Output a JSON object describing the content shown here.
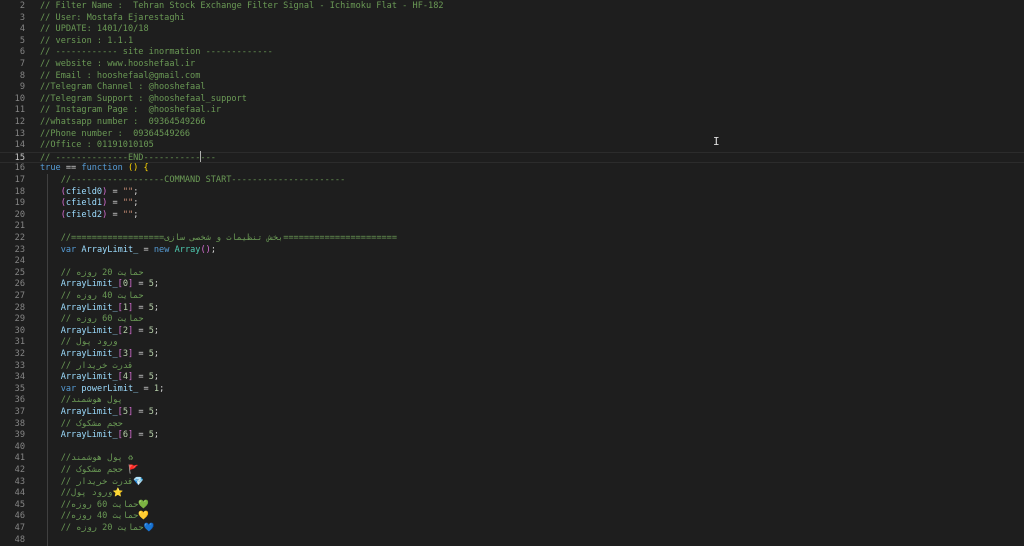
{
  "lines": [
    {
      "num": "2",
      "tokens": [
        {
          "t": "// Filter Name :  Tehran Stock Exchange Filter Signal - Ichimoku Flat - HF-182",
          "c": "c"
        }
      ]
    },
    {
      "num": "3",
      "tokens": [
        {
          "t": "// User: Mostafa Ejarestaghi",
          "c": "c"
        }
      ]
    },
    {
      "num": "4",
      "tokens": [
        {
          "t": "// UPDATE: 1401/10/18",
          "c": "c"
        }
      ]
    },
    {
      "num": "5",
      "tokens": [
        {
          "t": "// version : 1.1.1",
          "c": "c"
        }
      ]
    },
    {
      "num": "6",
      "tokens": [
        {
          "t": "// ------------ site inormation -------------",
          "c": "c"
        }
      ]
    },
    {
      "num": "7",
      "tokens": [
        {
          "t": "// website : www.hooshefaal.ir",
          "c": "c"
        }
      ]
    },
    {
      "num": "8",
      "tokens": [
        {
          "t": "// Email : hooshefaal@gmail.com",
          "c": "c"
        }
      ]
    },
    {
      "num": "9",
      "tokens": [
        {
          "t": "//Telegram Channel : @hooshefaal",
          "c": "c"
        }
      ]
    },
    {
      "num": "10",
      "tokens": [
        {
          "t": "//Telegram Support : @hooshefaal_support",
          "c": "c"
        }
      ]
    },
    {
      "num": "11",
      "tokens": [
        {
          "t": "// Instagram Page :  @hooshefaal.ir",
          "c": "c"
        }
      ]
    },
    {
      "num": "12",
      "tokens": [
        {
          "t": "//whatsapp number :  09364549266",
          "c": "c"
        }
      ]
    },
    {
      "num": "13",
      "tokens": [
        {
          "t": "//Phone number :  09364549266",
          "c": "c"
        }
      ]
    },
    {
      "num": "14",
      "tokens": [
        {
          "t": "//Office : 01191010105",
          "c": "c"
        }
      ]
    },
    {
      "num": "15",
      "current": true,
      "tokens": [
        {
          "t": "// --------------END--------------",
          "c": "c"
        }
      ]
    },
    {
      "num": "16",
      "tokens": [
        {
          "t": "true",
          "c": "k"
        },
        {
          "t": " == ",
          "c": "p"
        },
        {
          "t": "function",
          "c": "k"
        },
        {
          "t": " ",
          "c": "p"
        },
        {
          "t": "()",
          "c": "b1"
        },
        {
          "t": " ",
          "c": "p"
        },
        {
          "t": "{",
          "c": "b1"
        }
      ]
    },
    {
      "num": "17",
      "tokens": [
        {
          "t": "    //------------------COMMAND START----------------------",
          "c": "c"
        }
      ]
    },
    {
      "num": "18",
      "tokens": [
        {
          "t": "    ",
          "c": "p"
        },
        {
          "t": "(",
          "c": "b2"
        },
        {
          "t": "cfield0",
          "c": "v"
        },
        {
          "t": ")",
          "c": "b2"
        },
        {
          "t": " = ",
          "c": "p"
        },
        {
          "t": "\"\"",
          "c": "s"
        },
        {
          "t": ";",
          "c": "p"
        }
      ]
    },
    {
      "num": "19",
      "tokens": [
        {
          "t": "    ",
          "c": "p"
        },
        {
          "t": "(",
          "c": "b2"
        },
        {
          "t": "cfield1",
          "c": "v"
        },
        {
          "t": ")",
          "c": "b2"
        },
        {
          "t": " = ",
          "c": "p"
        },
        {
          "t": "\"\"",
          "c": "s"
        },
        {
          "t": ";",
          "c": "p"
        }
      ]
    },
    {
      "num": "20",
      "tokens": [
        {
          "t": "    ",
          "c": "p"
        },
        {
          "t": "(",
          "c": "b2"
        },
        {
          "t": "cfield2",
          "c": "v"
        },
        {
          "t": ")",
          "c": "b2"
        },
        {
          "t": " = ",
          "c": "p"
        },
        {
          "t": "\"\"",
          "c": "s"
        },
        {
          "t": ";",
          "c": "p"
        }
      ]
    },
    {
      "num": "21",
      "tokens": []
    },
    {
      "num": "22",
      "tokens": [
        {
          "t": "    //==================بخش تنظیمات و شخصی سازی======================",
          "c": "c"
        }
      ]
    },
    {
      "num": "23",
      "tokens": [
        {
          "t": "    ",
          "c": "p"
        },
        {
          "t": "var",
          "c": "k"
        },
        {
          "t": " ",
          "c": "p"
        },
        {
          "t": "ArrayLimit_",
          "c": "v"
        },
        {
          "t": " = ",
          "c": "p"
        },
        {
          "t": "new",
          "c": "k"
        },
        {
          "t": " ",
          "c": "p"
        },
        {
          "t": "Array",
          "c": "t"
        },
        {
          "t": "()",
          "c": "b2"
        },
        {
          "t": ";",
          "c": "p"
        }
      ]
    },
    {
      "num": "24",
      "tokens": []
    },
    {
      "num": "25",
      "tokens": [
        {
          "t": "    // حمایت 20 روزه",
          "c": "c"
        }
      ]
    },
    {
      "num": "26",
      "tokens": [
        {
          "t": "    ",
          "c": "p"
        },
        {
          "t": "ArrayLimit_",
          "c": "v"
        },
        {
          "t": "[",
          "c": "b2"
        },
        {
          "t": "0",
          "c": "n"
        },
        {
          "t": "]",
          "c": "b2"
        },
        {
          "t": " = ",
          "c": "p"
        },
        {
          "t": "5",
          "c": "n"
        },
        {
          "t": ";",
          "c": "p"
        }
      ]
    },
    {
      "num": "27",
      "tokens": [
        {
          "t": "    // حمایت 40 روزه",
          "c": "c"
        }
      ]
    },
    {
      "num": "28",
      "tokens": [
        {
          "t": "    ",
          "c": "p"
        },
        {
          "t": "ArrayLimit_",
          "c": "v"
        },
        {
          "t": "[",
          "c": "b2"
        },
        {
          "t": "1",
          "c": "n"
        },
        {
          "t": "]",
          "c": "b2"
        },
        {
          "t": " = ",
          "c": "p"
        },
        {
          "t": "5",
          "c": "n"
        },
        {
          "t": ";",
          "c": "p"
        }
      ]
    },
    {
      "num": "29",
      "tokens": [
        {
          "t": "    // حمایت 60 روزه",
          "c": "c"
        }
      ]
    },
    {
      "num": "30",
      "tokens": [
        {
          "t": "    ",
          "c": "p"
        },
        {
          "t": "ArrayLimit_",
          "c": "v"
        },
        {
          "t": "[",
          "c": "b2"
        },
        {
          "t": "2",
          "c": "n"
        },
        {
          "t": "]",
          "c": "b2"
        },
        {
          "t": " = ",
          "c": "p"
        },
        {
          "t": "5",
          "c": "n"
        },
        {
          "t": ";",
          "c": "p"
        }
      ]
    },
    {
      "num": "31",
      "tokens": [
        {
          "t": "    // ورود پول",
          "c": "c"
        }
      ]
    },
    {
      "num": "32",
      "tokens": [
        {
          "t": "    ",
          "c": "p"
        },
        {
          "t": "ArrayLimit_",
          "c": "v"
        },
        {
          "t": "[",
          "c": "b2"
        },
        {
          "t": "3",
          "c": "n"
        },
        {
          "t": "]",
          "c": "b2"
        },
        {
          "t": " = ",
          "c": "p"
        },
        {
          "t": "5",
          "c": "n"
        },
        {
          "t": ";",
          "c": "p"
        }
      ]
    },
    {
      "num": "33",
      "tokens": [
        {
          "t": "    // قدرت خریدار",
          "c": "c"
        }
      ]
    },
    {
      "num": "34",
      "tokens": [
        {
          "t": "    ",
          "c": "p"
        },
        {
          "t": "ArrayLimit_",
          "c": "v"
        },
        {
          "t": "[",
          "c": "b2"
        },
        {
          "t": "4",
          "c": "n"
        },
        {
          "t": "]",
          "c": "b2"
        },
        {
          "t": " = ",
          "c": "p"
        },
        {
          "t": "5",
          "c": "n"
        },
        {
          "t": ";",
          "c": "p"
        }
      ]
    },
    {
      "num": "35",
      "tokens": [
        {
          "t": "    ",
          "c": "p"
        },
        {
          "t": "var",
          "c": "k"
        },
        {
          "t": " ",
          "c": "p"
        },
        {
          "t": "powerLimit_",
          "c": "v"
        },
        {
          "t": " = ",
          "c": "p"
        },
        {
          "t": "1",
          "c": "n"
        },
        {
          "t": ";",
          "c": "p"
        }
      ]
    },
    {
      "num": "36",
      "tokens": [
        {
          "t": "    //پول هوشمند",
          "c": "c"
        }
      ]
    },
    {
      "num": "37",
      "tokens": [
        {
          "t": "    ",
          "c": "p"
        },
        {
          "t": "ArrayLimit_",
          "c": "v"
        },
        {
          "t": "[",
          "c": "b2"
        },
        {
          "t": "5",
          "c": "n"
        },
        {
          "t": "]",
          "c": "b2"
        },
        {
          "t": " = ",
          "c": "p"
        },
        {
          "t": "5",
          "c": "n"
        },
        {
          "t": ";",
          "c": "p"
        }
      ]
    },
    {
      "num": "38",
      "tokens": [
        {
          "t": "    // حجم مشکوک",
          "c": "c"
        }
      ]
    },
    {
      "num": "39",
      "tokens": [
        {
          "t": "    ",
          "c": "p"
        },
        {
          "t": "ArrayLimit_",
          "c": "v"
        },
        {
          "t": "[",
          "c": "b2"
        },
        {
          "t": "6",
          "c": "n"
        },
        {
          "t": "]",
          "c": "b2"
        },
        {
          "t": " = ",
          "c": "p"
        },
        {
          "t": "5",
          "c": "n"
        },
        {
          "t": ";",
          "c": "p"
        }
      ]
    },
    {
      "num": "40",
      "tokens": []
    },
    {
      "num": "41",
      "tokens": [
        {
          "t": "    //پول هوشمند ♻",
          "c": "c"
        }
      ]
    },
    {
      "num": "42",
      "tokens": [
        {
          "t": "    // حجم مشکوک 🚩",
          "c": "c"
        }
      ]
    },
    {
      "num": "43",
      "tokens": [
        {
          "t": "    // قدرت خریدار💎",
          "c": "c"
        }
      ]
    },
    {
      "num": "44",
      "tokens": [
        {
          "t": "    //ورود پول⭐",
          "c": "c"
        }
      ]
    },
    {
      "num": "45",
      "tokens": [
        {
          "t": "    //حمایت 60 روزه💚",
          "c": "c"
        }
      ]
    },
    {
      "num": "46",
      "tokens": [
        {
          "t": "    //حمایت 40 روزه💛",
          "c": "c"
        }
      ]
    },
    {
      "num": "47",
      "tokens": [
        {
          "t": "    // حمایت 20 روزه💙",
          "c": "c"
        }
      ]
    },
    {
      "num": "48",
      "tokens": []
    }
  ]
}
